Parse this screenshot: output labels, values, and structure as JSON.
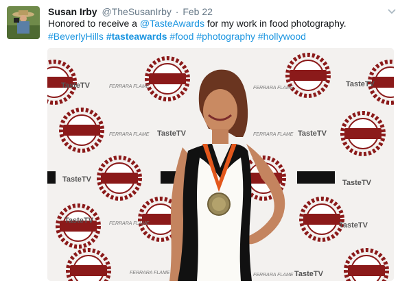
{
  "author": {
    "display_name": "Susan Irby",
    "handle": "@TheSusanIrby",
    "separator": "·",
    "timestamp": "Feb 22",
    "avatar_icon": "avatar-photo"
  },
  "tweet": {
    "text_before": "Honored to receive a ",
    "mention": "@TasteAwards",
    "text_after": " for my work in food photography.",
    "hashtag_1": "#BeverlyHills",
    "hashtag_2": "#tasteawards",
    "hashtag_3": "#food",
    "hashtag_4": "#photography",
    "hashtag_5": "#hollywood"
  },
  "media": {
    "backdrop_logo_1_line1": "THE",
    "backdrop_logo_1_line2": "TASTE",
    "backdrop_logo_1_line3": "AWARDS",
    "backdrop_brand_1": "TasteTV",
    "backdrop_brand_2": "FERRARA FLAME"
  },
  "menu": {
    "caret_icon": "chevron-down-icon"
  },
  "colors": {
    "link": "#1b95e0",
    "text": "#14171a",
    "muted": "#657786",
    "logo_red": "#8b1a1a"
  }
}
